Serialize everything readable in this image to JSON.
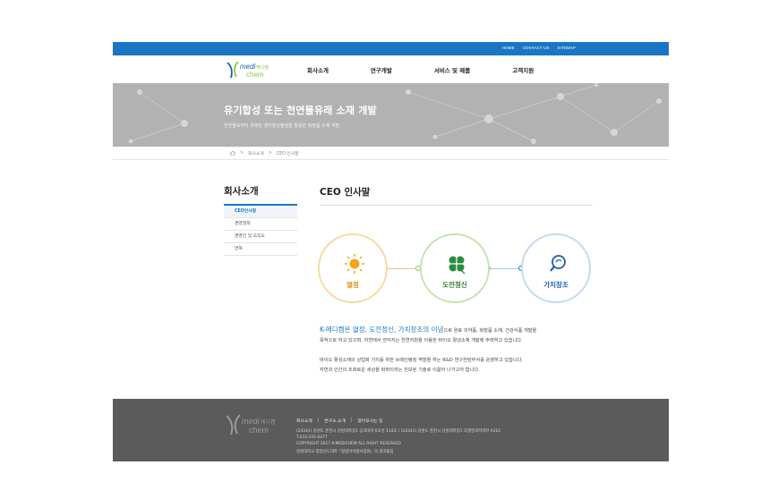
{
  "topbar": {
    "links": [
      "HOME",
      "CONTACT US",
      "SITEMAP"
    ]
  },
  "logo": {
    "text_medi": "medi",
    "text_korean": "케디켐",
    "text_chem": "chem",
    "letter_k": "K"
  },
  "nav": {
    "items": [
      "회사소개",
      "연구개발",
      "서비스 및 제품",
      "고객지원"
    ]
  },
  "hero": {
    "title": "유기합성 또는 천연물유래 소재 개발",
    "subtitle": "천연물로부터 유래된 생리활성물질을 활용한 화장품 소재 개발"
  },
  "breadcrumb": {
    "items": [
      "회사소개",
      "CEO 인사말"
    ]
  },
  "sidebar": {
    "title": "회사소개",
    "items": [
      "CEO인사말",
      "경영철학",
      "경영진 및 조직도",
      "연혁"
    ]
  },
  "main": {
    "title": "CEO 인사말",
    "values": [
      {
        "label": "열정",
        "color": "#f4a31c",
        "icon": "sun-icon"
      },
      {
        "label": "도전정신",
        "color": "#2e8b3e",
        "icon": "clover-icon"
      },
      {
        "label": "가치창조",
        "color": "#1a5fb4",
        "icon": "lightbulb-icon"
      }
    ],
    "para1_highlight": "K-메디켐은 열정, 도전정신, 가치창조의 이념",
    "para1_rest": "으로 원료 의약품, 화장품 소재, 건강식품 개발을",
    "para1_line2": "목적으로 하고 있으며, 자연에서 얻어지는 천연자원을 이용한 바이오 활성소재 개발에 주력하고 있습니다.",
    "para2_line1": "바이오 활성소재의 상업화 가치를 위한 브레인탱킹 역할을 하는 R&D 연구전담부서를 운영하고 있습니다.",
    "para2_line2": "자연과 인간의 조화로운 세상을 화학이라는 진보된 기술로 이끌어 나가고자 합니다."
  },
  "footer": {
    "links": [
      "회사소개",
      "연구소 소개",
      "찾아오시는 길"
    ],
    "address": "(24341) 강원도 춘천시 강원대학길1 공과대학 6호관 114호 / (24341) 강원도 춘천시 강원대학길1 의생명과학대학 A310",
    "tel": "T.033-255-6477",
    "copyright": "COPYRIGHT 2017 K-MEDICHEM ALL RIGHT RESERVED",
    "credit": "강원대학교 창업선도대학「창업아이템사업화」의 결과물임"
  },
  "colors": {
    "brand_blue": "#1a76c4",
    "logo_green": "#8cc63f",
    "logo_blue": "#1a5fb4",
    "hero_gray": "#b2b2b2",
    "footer_gray": "#5b5b5b"
  }
}
